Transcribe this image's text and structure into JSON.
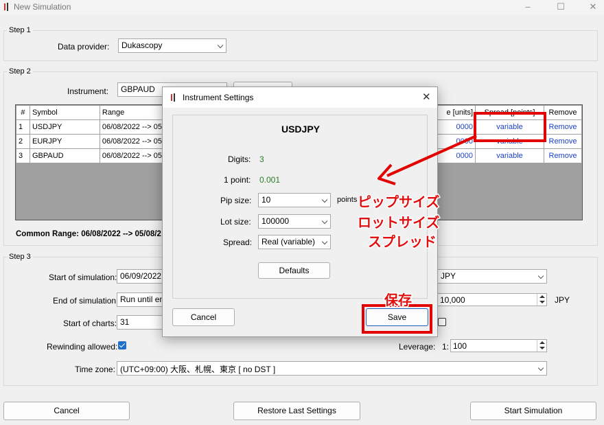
{
  "window": {
    "title": "New Simulation"
  },
  "step1": {
    "label": "Step 1",
    "provider_label": "Data provider:",
    "provider_value": "Dukascopy"
  },
  "step2": {
    "label": "Step 2",
    "instrument_label": "Instrument:",
    "instrument_value": "GBPAUD",
    "columns": [
      "#",
      "Symbol",
      "Range",
      "e [units]",
      "Spread [points]",
      "Remove"
    ],
    "rows": [
      {
        "num": "1",
        "symbol": "USDJPY",
        "range": "06/08/2022 --> 05/",
        "units": "0000",
        "spread": "variable",
        "remove": "Remove"
      },
      {
        "num": "2",
        "symbol": "EURJPY",
        "range": "06/08/2022 --> 05/",
        "units": "0000",
        "spread": "variable",
        "remove": "Remove"
      },
      {
        "num": "3",
        "symbol": "GBPAUD",
        "range": "06/08/2022 --> 05/",
        "units": "0000",
        "spread": "variable",
        "remove": "Remove"
      }
    ],
    "common_range": "Common Range: 06/08/2022 --> 05/08/2"
  },
  "step3": {
    "label": "Step 3",
    "start_sim_label": "Start of simulation:",
    "start_sim_value": "06/09/2022",
    "end_sim_label": "End of simulation:",
    "end_sim_value": "Run until end",
    "start_charts_label": "Start of charts:",
    "start_charts_value": "31",
    "rewinding_label": "Rewinding allowed:",
    "currency_value": "JPY",
    "deposit_value": "10,000",
    "deposit_unit": "JPY",
    "leverage_label": "Leverage:",
    "leverage_prefix": "1:",
    "leverage_value": "100",
    "timezone_label": "Time zone:",
    "timezone_value": "(UTC+09:00) 大阪、札幌、東京 [ no DST ]"
  },
  "footer": {
    "cancel": "Cancel",
    "restore": "Restore Last Settings",
    "start": "Start Simulation"
  },
  "dialog": {
    "title": "Instrument Settings",
    "symbol": "USDJPY",
    "digits_label": "Digits:",
    "digits_value": "3",
    "point_label": "1 point:",
    "point_value": "0.001",
    "pip_label": "Pip size:",
    "pip_value": "10",
    "pip_unit": "points",
    "lot_label": "Lot size:",
    "lot_value": "100000",
    "spread_label": "Spread:",
    "spread_value": "Real (variable)",
    "defaults": "Defaults",
    "cancel": "Cancel",
    "save": "Save"
  },
  "annotations": {
    "pip": "ピップサイズ",
    "lot": "ロットサイズ",
    "spread": "スプレッド",
    "save": "保存",
    "color": "#e20000"
  }
}
